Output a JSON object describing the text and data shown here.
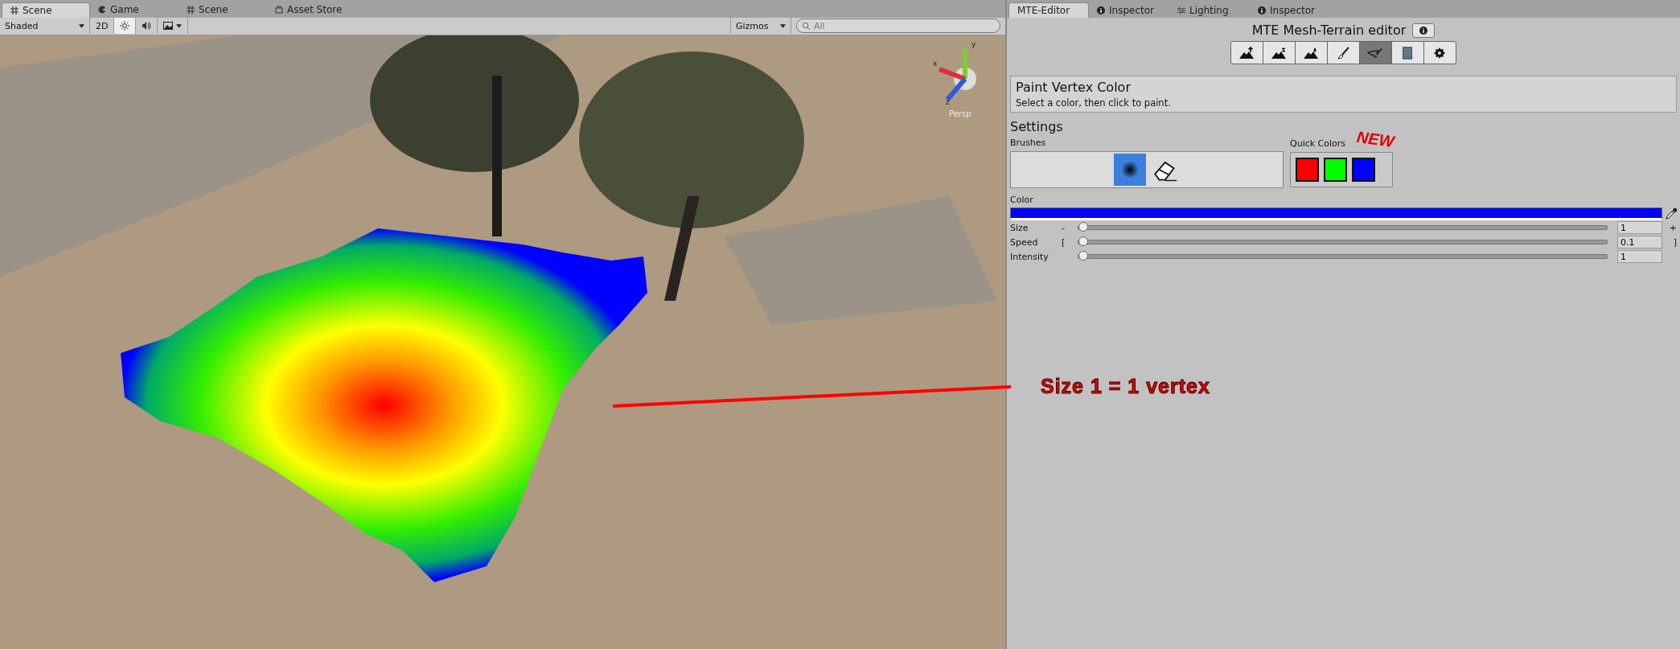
{
  "scene_tabs": [
    {
      "label": "Scene",
      "kind": "grid",
      "selected": true
    },
    {
      "label": "Game",
      "kind": "game",
      "selected": false
    },
    {
      "label": "Scene",
      "kind": "grid",
      "selected": false
    },
    {
      "label": "Asset Store",
      "kind": "store",
      "selected": false
    }
  ],
  "scene_toolbar": {
    "shading": "Shaded",
    "mode_2d": "2D",
    "gizmos": "Gizmos",
    "search_placeholder": "All"
  },
  "scene_view": {
    "axes": [
      "y",
      "x",
      "z"
    ],
    "projection": "Persp"
  },
  "annotation": {
    "text": "Size 1 = 1 vertex"
  },
  "panel_tabs": [
    {
      "label": "MTE-Editor",
      "kind": "plain",
      "selected": true
    },
    {
      "label": "Inspector",
      "kind": "info",
      "selected": false
    },
    {
      "label": "Lighting",
      "kind": "lighting",
      "selected": false
    },
    {
      "label": "Inspector",
      "kind": "info",
      "selected": false
    }
  ],
  "editor": {
    "title": "MTE Mesh-Terrain editor",
    "tools": [
      {
        "kind": "raise",
        "selected": false
      },
      {
        "kind": "sculpt",
        "selected": false
      },
      {
        "kind": "smooth",
        "selected": false
      },
      {
        "kind": "paint",
        "selected": false
      },
      {
        "kind": "vertex",
        "selected": true
      },
      {
        "kind": "grid",
        "selected": false
      },
      {
        "kind": "settings",
        "selected": false
      }
    ],
    "mode": {
      "title": "Paint Vertex Color",
      "description": "Select a color, then click to paint."
    },
    "settings_heading": "Settings",
    "brushes_label": "Brushes",
    "brushes": [
      {
        "kind": "soft",
        "selected": true
      },
      {
        "kind": "eraser",
        "selected": false
      }
    ],
    "quick_colors_label": "Quick Colors",
    "new_badge": "NEW",
    "quick_colors": [
      {
        "color": "#ff0000"
      },
      {
        "color": "#00ff00"
      },
      {
        "color": "#0000ff"
      }
    ],
    "color_label": "Color",
    "color": "#0000ff",
    "sliders": [
      {
        "label": "Size",
        "left": "-",
        "right": "+",
        "level": 0,
        "value": "1"
      },
      {
        "label": "Speed",
        "left": "[",
        "right": "]",
        "level": 0,
        "value": "0.1"
      },
      {
        "label": "Intensity",
        "level": 0,
        "value": "1"
      }
    ]
  }
}
